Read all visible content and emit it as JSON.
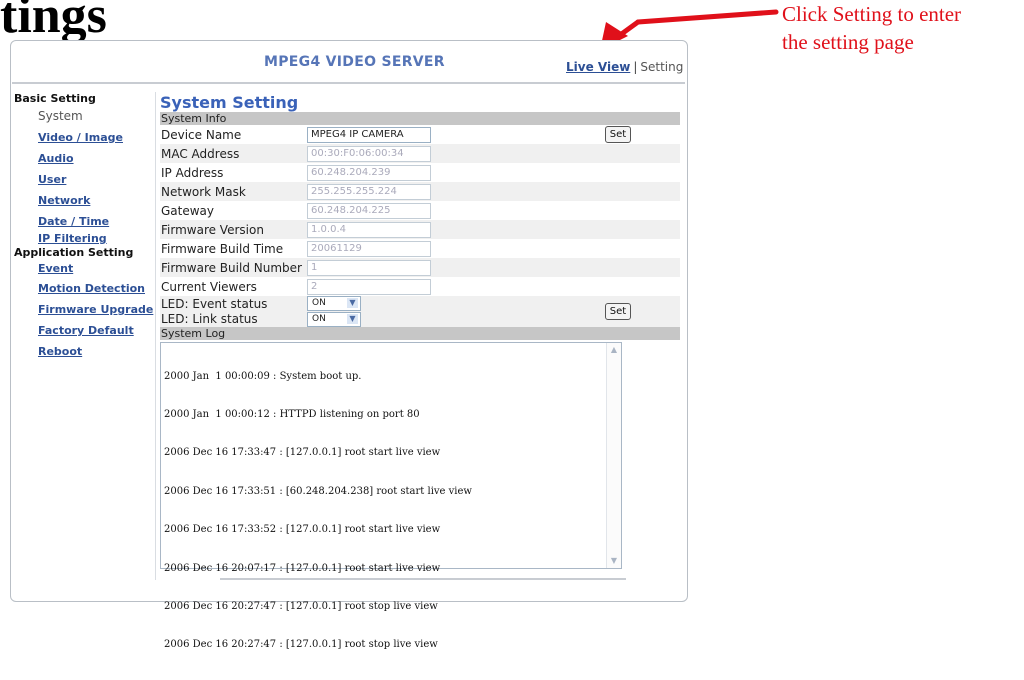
{
  "document": {
    "heading_fragment": "tings",
    "callout": [
      "Click Setting to enter",
      "the setting page"
    ]
  },
  "colors": {
    "callout_red": "#e0101a",
    "link_blue": "#2c4f95",
    "title_blue": "#3a62b8",
    "section_gray": "#c6c6c6"
  },
  "banner": {
    "title": "MPEG4 VIDEO SERVER"
  },
  "topnav": {
    "live_view": "Live View",
    "separator": "|",
    "setting": "Setting"
  },
  "sidebar": {
    "basic_header": "Basic Setting",
    "basic_items": [
      "System",
      "Video / Image",
      "Audio",
      "User",
      "Network",
      "Date / Time",
      "IP Filtering"
    ],
    "app_header": "Application Setting",
    "app_items": [
      "Event",
      "Motion Detection",
      "Firmware Upgrade",
      "Factory Default",
      "Reboot"
    ]
  },
  "main": {
    "title": "System Setting",
    "info_section": "System Info",
    "fields": [
      {
        "label": "Device Name",
        "value": "MPEG4 IP CAMERA"
      },
      {
        "label": "MAC Address",
        "value": "00:30:F0:06:00:34"
      },
      {
        "label": "IP Address",
        "value": "60.248.204.239"
      },
      {
        "label": "Network Mask",
        "value": "255.255.255.224"
      },
      {
        "label": "Gateway",
        "value": "60.248.204.225"
      },
      {
        "label": "Firmware Version",
        "value": "1.0.0.4"
      },
      {
        "label": "Firmware Build Time",
        "value": "20061129"
      },
      {
        "label": "Firmware Build Number",
        "value": "1"
      },
      {
        "label": "Current Viewers",
        "value": "2"
      }
    ],
    "led_event": {
      "label": "LED: Event status",
      "value": "ON"
    },
    "led_link": {
      "label": "LED: Link status",
      "value": "ON"
    },
    "set_label": "Set",
    "log_section": "System Log",
    "log_lines": [
      "2000 Jan  1 00:00:09 : System boot up.",
      "2000 Jan  1 00:00:12 : HTTPD listening on port 80",
      "2006 Dec 16 17:33:47 : [127.0.0.1] root start live view",
      "2006 Dec 16 17:33:51 : [60.248.204.238] root start live view",
      "2006 Dec 16 17:33:52 : [127.0.0.1] root start live view",
      "2006 Dec 16 20:07:17 : [127.0.0.1] root start live view",
      "2006 Dec 16 20:27:47 : [127.0.0.1] root stop live view",
      "2006 Dec 16 20:27:47 : [127.0.0.1] root stop live view"
    ]
  },
  "icons": {
    "dropdown": "chevron-down-icon",
    "scroll_up": "scroll-up-icon",
    "scroll_down": "scroll-down-icon",
    "arrow": "callout-arrow-icon"
  }
}
